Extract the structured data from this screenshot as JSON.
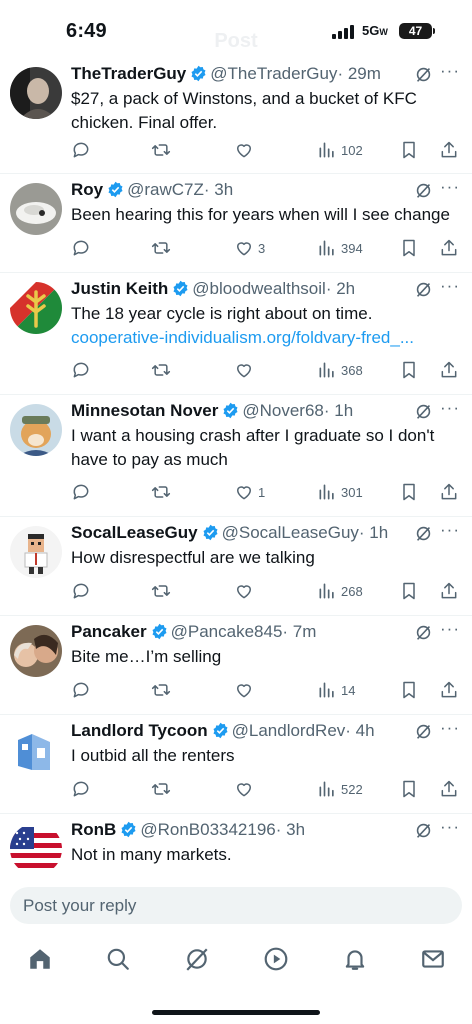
{
  "status_bar": {
    "time": "6:49",
    "network": "5G",
    "battery": "47"
  },
  "header": {
    "title": "Post"
  },
  "reply_box": {
    "placeholder": "Post your reply"
  },
  "colors": {
    "accent": "#1d9bf0",
    "secondary_text": "#536471",
    "divider": "#eff3f4"
  },
  "tweets": [
    {
      "name": "TheTraderGuy",
      "handle": "@TheTraderGuy",
      "time": "· 29m",
      "text": "$27, a pack of Winstons, and a bucket of KFC chicken. Final offer.",
      "replies": "",
      "reposts": "",
      "likes": "",
      "views": "102"
    },
    {
      "name": "Roy",
      "handle": "@rawC7Z",
      "time": "· 3h",
      "text": "Been hearing this for years when will I see change",
      "replies": "",
      "reposts": "",
      "likes": "3",
      "views": "394"
    },
    {
      "name": "Justin Keith",
      "handle": "@bloodwealthsoil",
      "time": "· 2h",
      "text": "The 18 year cycle is right about on time.",
      "link": "cooperative-individualism.org/foldvary-fred_...",
      "replies": "",
      "reposts": "",
      "likes": "",
      "views": "368"
    },
    {
      "name": "Minnesotan Nover",
      "handle": "@Nover68",
      "time": "· 1h",
      "text": "I want a housing crash after I graduate so I don't have to pay as much",
      "replies": "",
      "reposts": "",
      "likes": "1",
      "views": "301"
    },
    {
      "name": "SocalLeaseGuy",
      "handle": "@SocalLeaseGuy",
      "time": "· 1h",
      "text": "How disrespectful are we talking",
      "replies": "",
      "reposts": "",
      "likes": "",
      "views": "268"
    },
    {
      "name": "Pancaker",
      "handle": "@Pancake845",
      "time": "· 7m",
      "text": "Bite me…I’m selling",
      "replies": "",
      "reposts": "",
      "likes": "",
      "views": "14"
    },
    {
      "name": "Landlord Tycoon",
      "handle": "@LandlordRev",
      "time": "· 4h",
      "text": "I outbid all the renters",
      "replies": "",
      "reposts": "",
      "likes": "",
      "views": "522"
    },
    {
      "name": "RonB",
      "handle": "@RonB03342196",
      "time": "· 3h",
      "text": "Not in many markets."
    }
  ],
  "icons": {
    "actions": [
      "reply-icon",
      "repost-icon",
      "like-icon",
      "views-icon",
      "bookmark-icon",
      "share-icon"
    ],
    "tabs": [
      "home-icon",
      "search-icon",
      "grok-icon",
      "video-icon",
      "notifications-icon",
      "messages-icon"
    ]
  }
}
